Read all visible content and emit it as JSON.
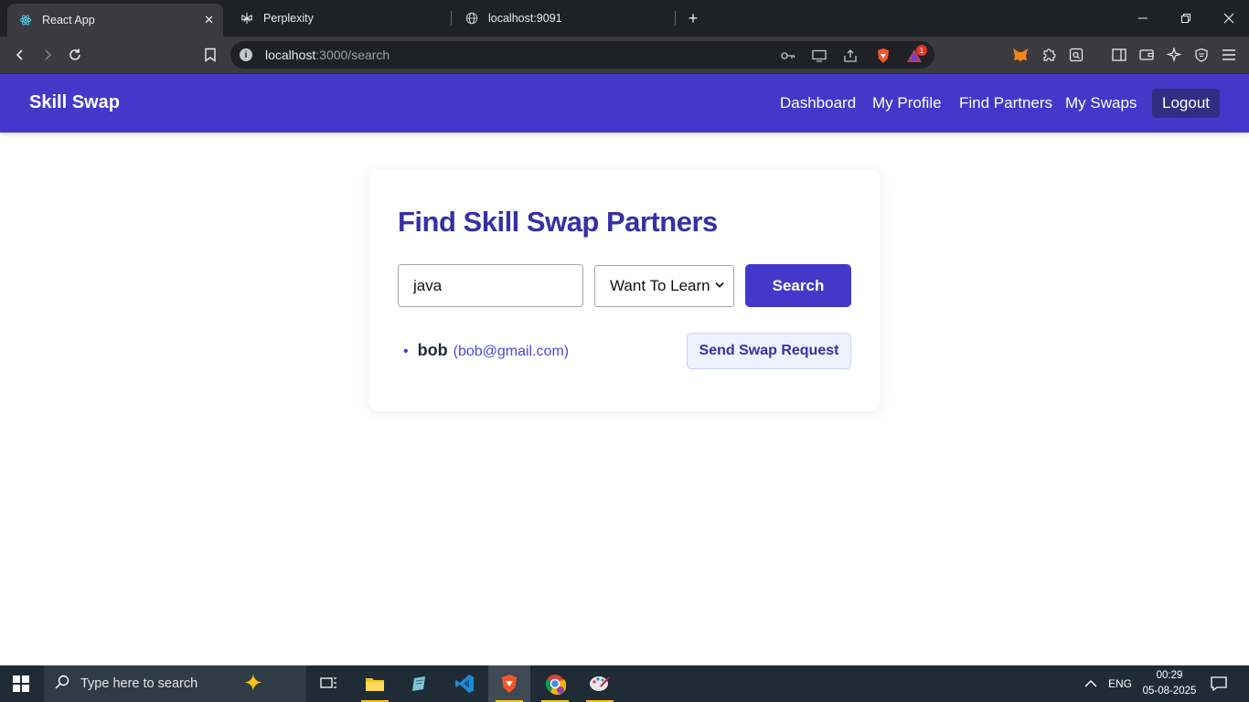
{
  "browser": {
    "tabs": [
      {
        "title": "React App",
        "active": true,
        "icon": "react-icon"
      },
      {
        "title": "Perplexity",
        "active": false,
        "icon": "perplexity-icon"
      },
      {
        "title": "localhost:9091",
        "active": false,
        "icon": "globe-icon"
      }
    ],
    "url_host": "localhost",
    "url_rest": ":3000/search",
    "shield_badge": "1"
  },
  "app": {
    "brand": "Skill Swap",
    "nav": {
      "dashboard": "Dashboard",
      "profile": "My Profile",
      "find": "Find Partners",
      "swaps": "My Swaps",
      "logout": "Logout"
    },
    "page_title": "Find Skill Swap Partners",
    "search": {
      "value": "java",
      "mode_selected": "Want To Learn",
      "button": "Search"
    },
    "results": [
      {
        "name": "bob",
        "email": "(bob@gmail.com)",
        "action": "Send Swap Request"
      }
    ],
    "colors": {
      "primary": "#4338ca",
      "title": "#3730a3",
      "nav_bg": "#4338ca"
    }
  },
  "taskbar": {
    "search_placeholder": "Type here to search",
    "language": "ENG",
    "time": "00:29",
    "date": "05-08-2025"
  }
}
